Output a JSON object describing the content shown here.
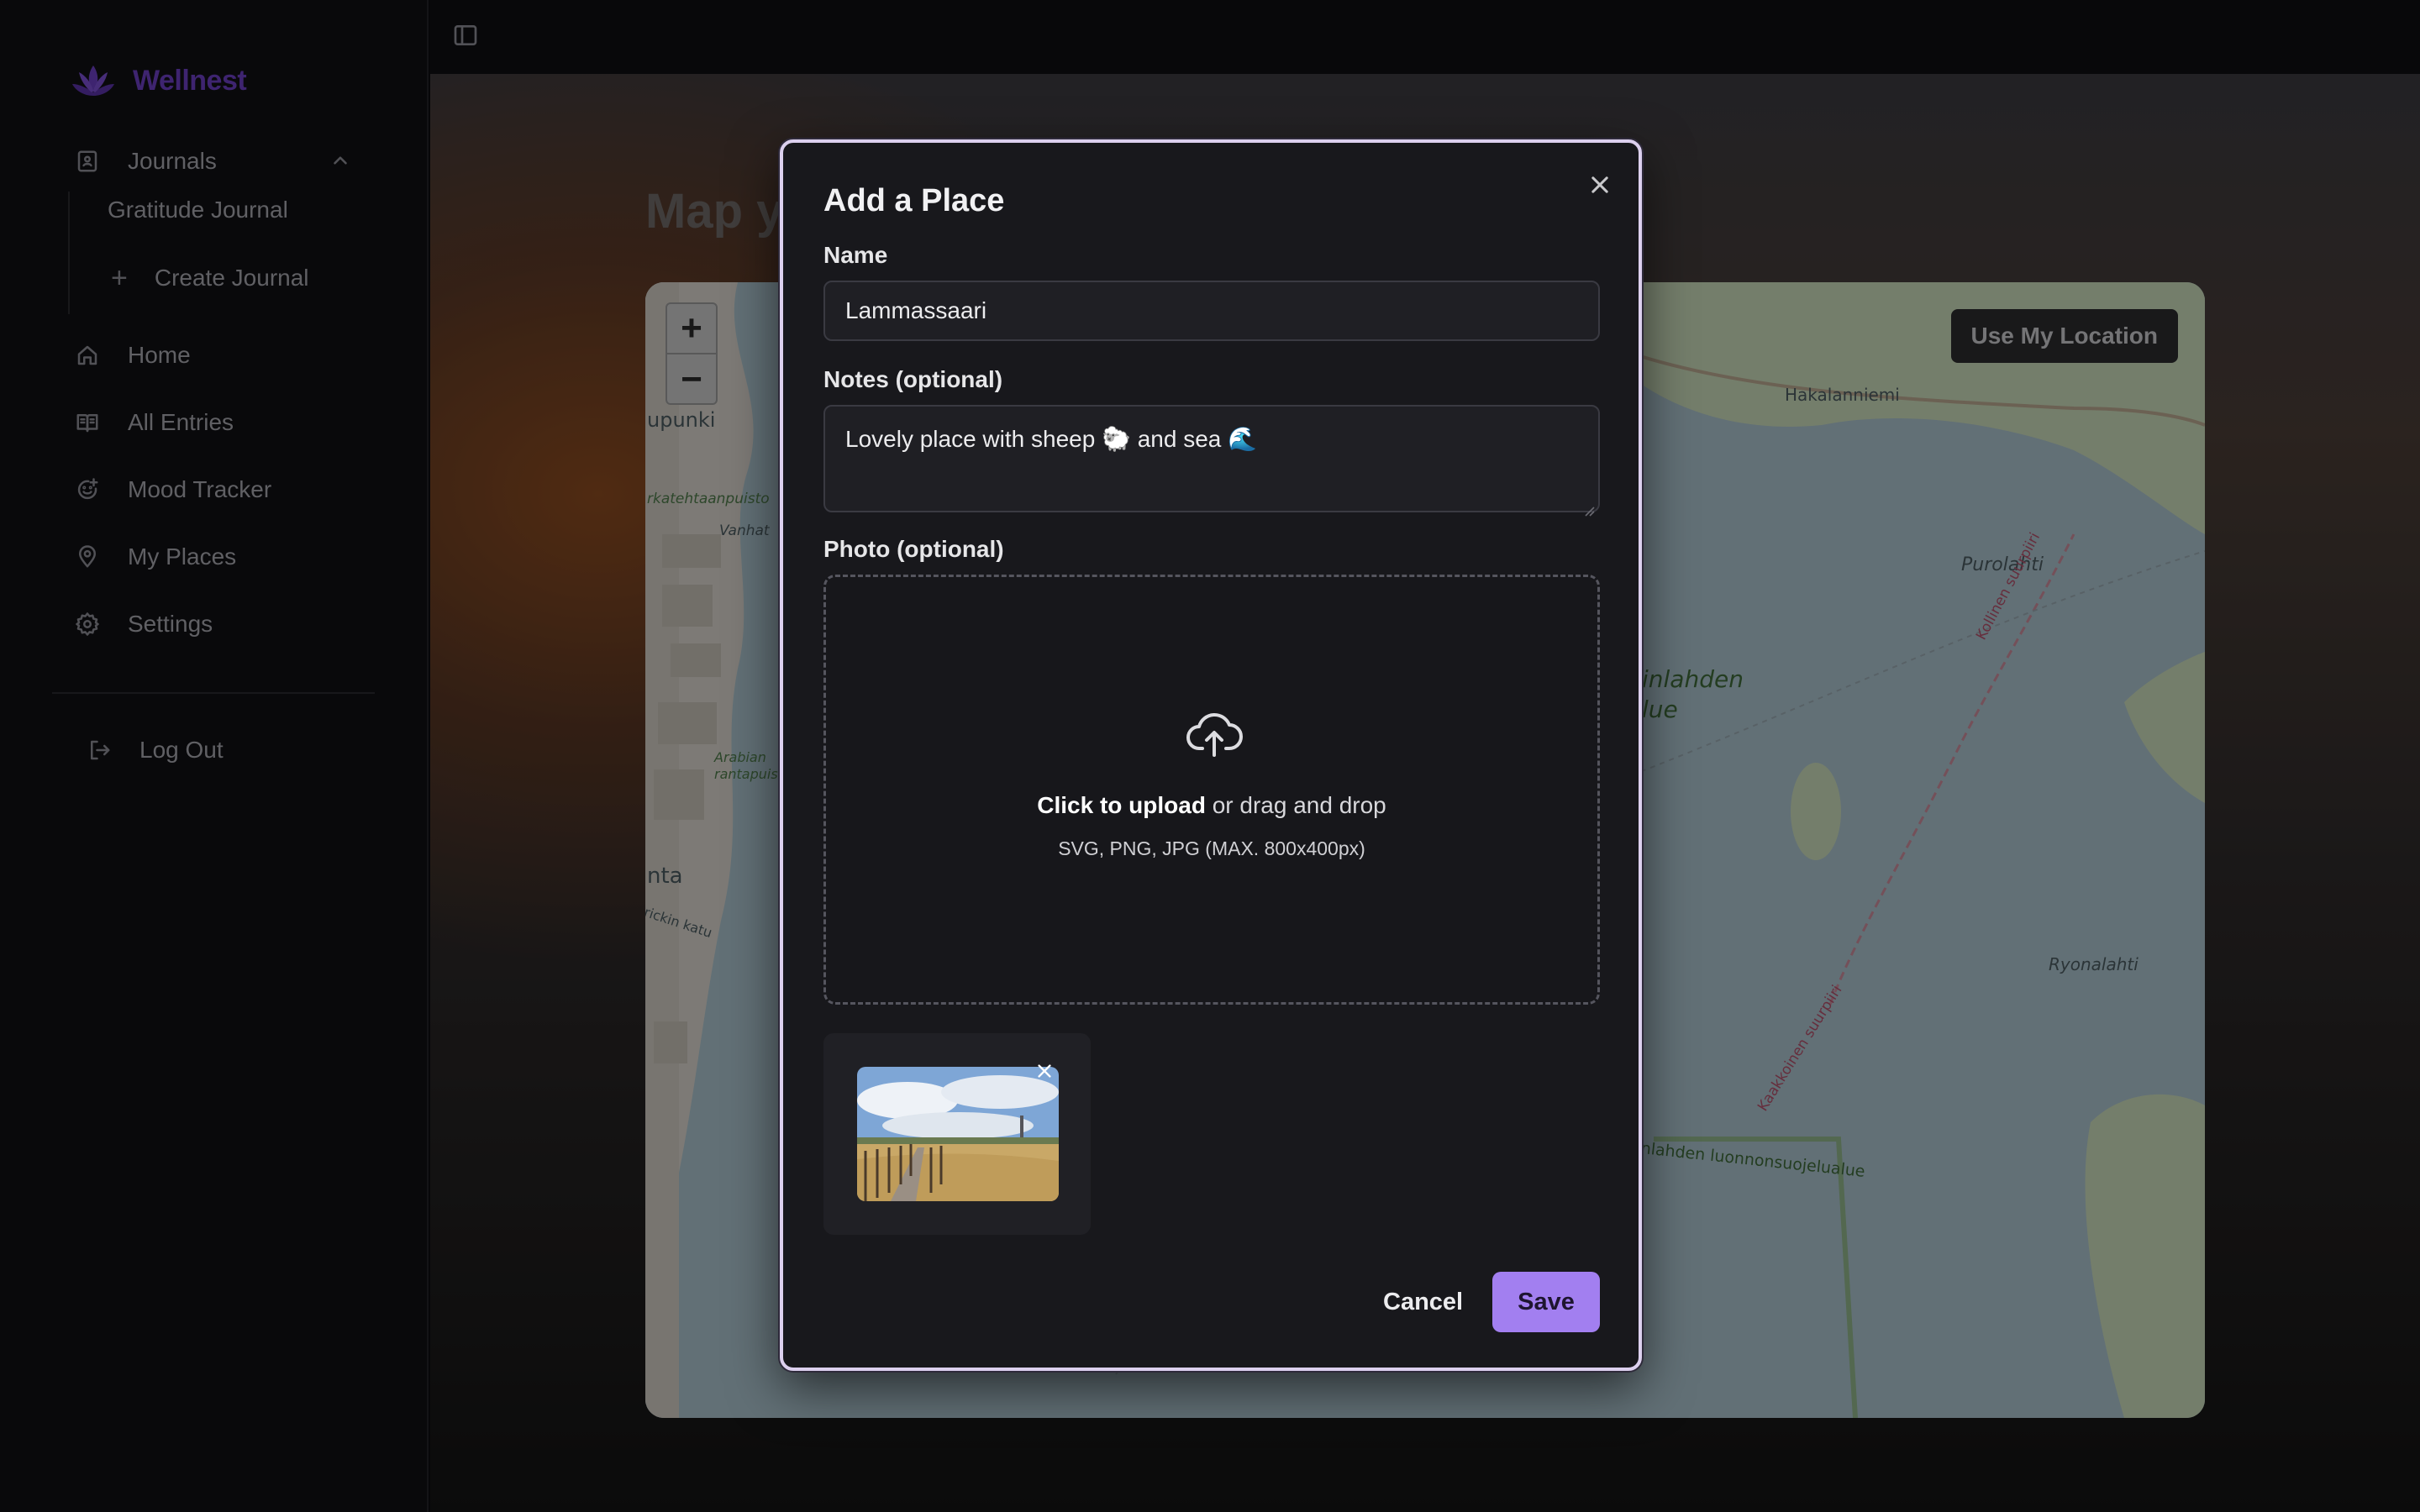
{
  "brand": {
    "name": "Wellnest",
    "logo_icon": "lotus-icon",
    "color": "#6b3fc2"
  },
  "sidebar": {
    "journals_label": "Journals",
    "sub_items": [
      {
        "label": "Gratitude Journal"
      },
      {
        "label": "Create Journal",
        "icon": "plus-icon"
      }
    ],
    "items": [
      {
        "label": "Home",
        "icon": "home-icon"
      },
      {
        "label": "All Entries",
        "icon": "book-open-icon"
      },
      {
        "label": "Mood Tracker",
        "icon": "smiley-plus-icon"
      },
      {
        "label": "My Places",
        "icon": "map-pin-icon"
      },
      {
        "label": "Settings",
        "icon": "gear-icon"
      }
    ],
    "logout_label": "Log Out"
  },
  "page": {
    "title": "Map y"
  },
  "map": {
    "use_location_label": "Use My Location",
    "zoom_in": "+",
    "zoom_out": "−",
    "labels": {
      "hakalanniemi": "Hakalanniemi",
      "purolahti": "Purolahti",
      "kollinen": "Kollinen suurpiiri",
      "inlahden": "inlahden",
      "lue": "lue",
      "ryonalahti": "Ryonalahti",
      "kaakkoinen": "Kaakkoinen suurpiiri",
      "luonnonsuojelualue": "nlahden luonnonsuojelualue",
      "upunki": "upunki",
      "rkatehtaanpuisto": "rkatehtaanpuisto",
      "vanhat": "Vanhat",
      "arabian": "Arabian rantapuisto",
      "nta": "nta",
      "rickin": "rickin katu"
    }
  },
  "modal": {
    "title": "Add a Place",
    "name_label": "Name",
    "name_value": "Lammassaari",
    "notes_label": "Notes (optional)",
    "notes_value": "Lovely place with sheep 🐑 and sea 🌊",
    "photo_label": "Photo (optional)",
    "upload_strong": "Click to upload",
    "upload_rest": " or drag and drop",
    "upload_hint": "SVG, PNG, JPG (MAX. 800x400px)",
    "cancel_label": "Cancel",
    "save_label": "Save",
    "accent": "#a27ff0"
  }
}
